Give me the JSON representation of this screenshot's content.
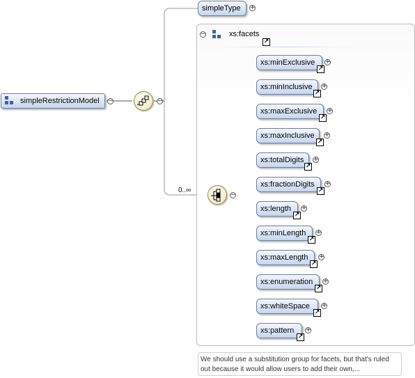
{
  "root": {
    "label": "simpleRestrictionModel"
  },
  "simple_type": {
    "label": "simpleType"
  },
  "occurrence": "0..∞",
  "group": {
    "label": "xs:facets"
  },
  "facets": [
    {
      "label": "xs:minExclusive"
    },
    {
      "label": "xs:minInclusive"
    },
    {
      "label": "xs:maxExclusive"
    },
    {
      "label": "xs:maxInclusive"
    },
    {
      "label": "xs:totalDigits"
    },
    {
      "label": "xs:fractionDigits"
    },
    {
      "label": "xs:length"
    },
    {
      "label": "xs:minLength"
    },
    {
      "label": "xs:maxLength"
    },
    {
      "label": "xs:enumeration"
    },
    {
      "label": "xs:whiteSpace"
    },
    {
      "label": "xs:pattern"
    }
  ],
  "annotation": "We should use a substitution group for facets, but that's ruled out because it would allow users to add their own,...",
  "icons": {
    "expand": "plus-icon",
    "collapse": "minus-icon",
    "reference": "reference-arrow-icon",
    "group": "group-icon",
    "sequence": "sequence-compositor-icon",
    "choice": "choice-compositor-icon"
  }
}
